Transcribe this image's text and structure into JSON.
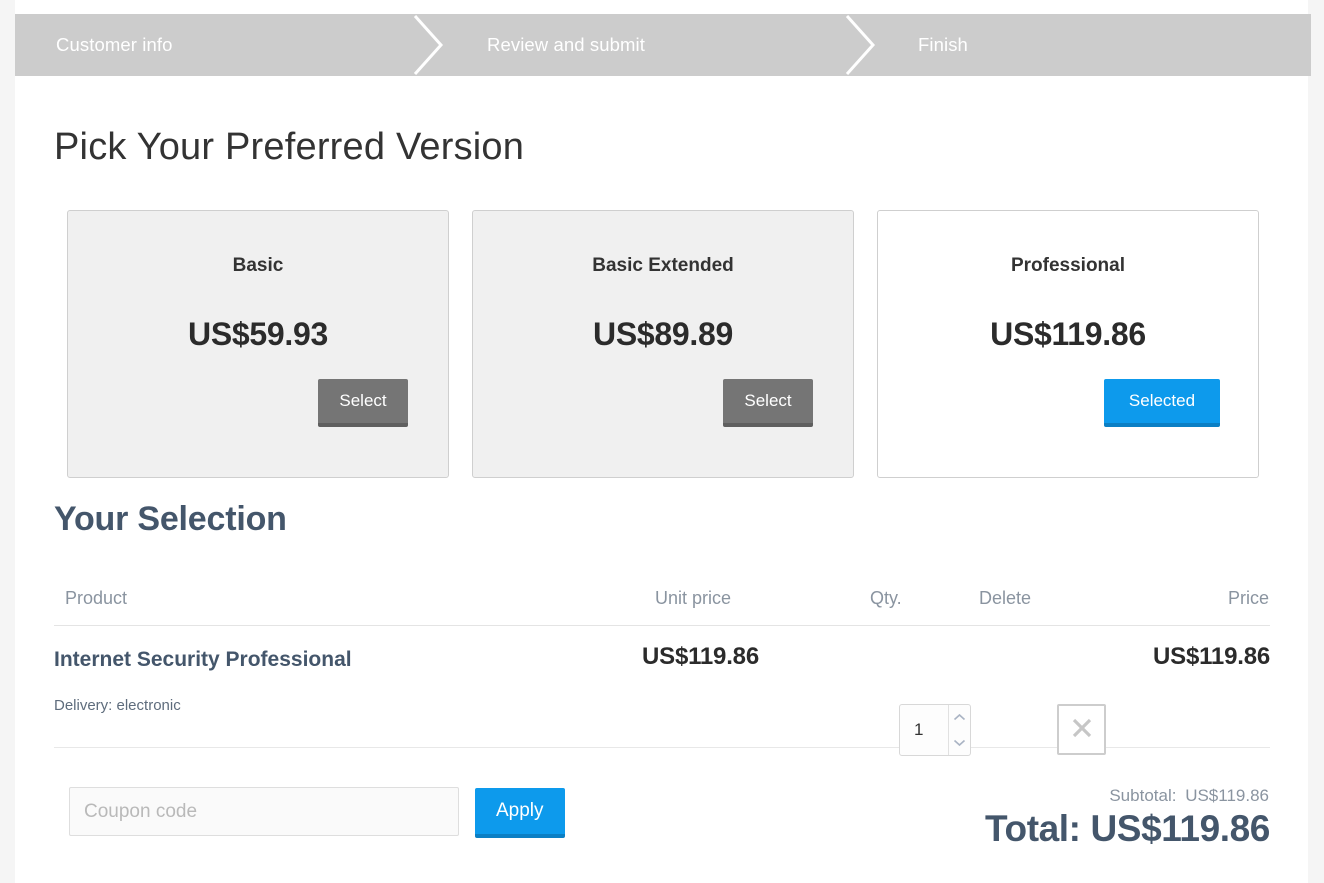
{
  "theme": {
    "accent": "#0d9aec",
    "accent_dark": "#0b7fc4",
    "stepper_bar": "#cccccc",
    "heading": "#44566b",
    "muted": "#8a94a0",
    "card_bg": "#f0f0f0",
    "select_button": "#757575"
  },
  "stepper": {
    "steps": [
      {
        "label": "Customer info"
      },
      {
        "label": "Review and submit"
      },
      {
        "label": "Finish"
      }
    ]
  },
  "main": {
    "title": "Pick Your Preferred Version",
    "selection_title": "Your Selection"
  },
  "plans": [
    {
      "name": "Basic",
      "price": "US$59.93",
      "button": "Select",
      "selected": false
    },
    {
      "name": "Basic Extended",
      "price": "US$89.89",
      "button": "Select",
      "selected": false
    },
    {
      "name": "Professional",
      "price": "US$119.86",
      "button": "Selected",
      "selected": true
    }
  ],
  "table": {
    "headers": {
      "product": "Product",
      "unit_price": "Unit price",
      "qty": "Qty.",
      "delete": "Delete",
      "price": "Price"
    },
    "rows": [
      {
        "product": "Internet Security Professional",
        "delivery": "Delivery: electronic",
        "unit_price": "US$119.86",
        "qty": "1",
        "price": "US$119.86"
      }
    ]
  },
  "coupon": {
    "placeholder": "Coupon code",
    "value": "",
    "apply_label": "Apply"
  },
  "totals": {
    "subtotal_label": "Subtotal:",
    "subtotal_value": "US$119.86",
    "total_text": "Total: US$119.86"
  },
  "icons": {
    "chevron_right": "chevron-right-icon",
    "chevron_up": "chevron-up-icon",
    "chevron_down": "chevron-down-icon",
    "close": "close-icon"
  }
}
